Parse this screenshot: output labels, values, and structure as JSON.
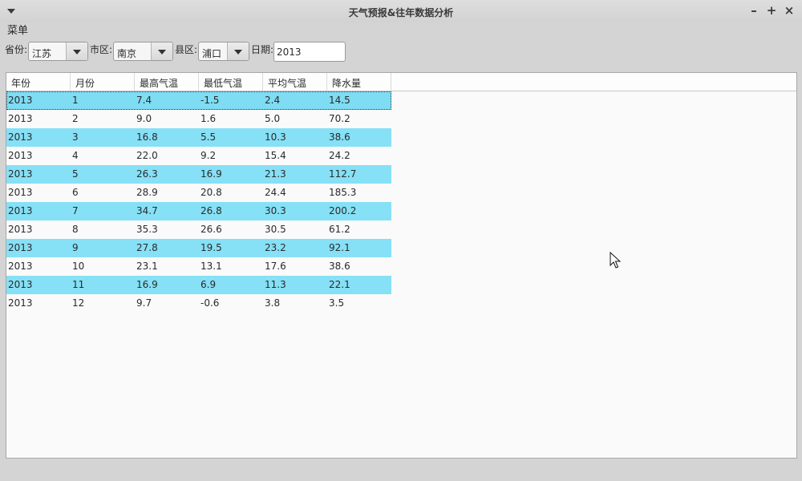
{
  "window": {
    "title": "天气预报&往年数据分析",
    "min_glyph": "–",
    "max_glyph": "+",
    "close_glyph": "×"
  },
  "menubar": {
    "menu_label": "菜单"
  },
  "filters": {
    "province_label": "省份:",
    "province_value": "江苏",
    "city_label": "市区:",
    "city_value": "南京",
    "county_label": "县区:",
    "county_value": "浦口",
    "date_label": "日期:",
    "date_value": "2013"
  },
  "table": {
    "headers": [
      "年份",
      "月份",
      "最高气温",
      "最低气温",
      "平均气温",
      "降水量"
    ],
    "rows": [
      [
        "2013",
        "1",
        "7.4",
        "-1.5",
        "2.4",
        "14.5"
      ],
      [
        "2013",
        "2",
        "9.0",
        "1.6",
        "5.0",
        "70.2"
      ],
      [
        "2013",
        "3",
        "16.8",
        "5.5",
        "10.3",
        "38.6"
      ],
      [
        "2013",
        "4",
        "22.0",
        "9.2",
        "15.4",
        "24.2"
      ],
      [
        "2013",
        "5",
        "26.3",
        "16.9",
        "21.3",
        "112.7"
      ],
      [
        "2013",
        "6",
        "28.9",
        "20.8",
        "24.4",
        "185.3"
      ],
      [
        "2013",
        "7",
        "34.7",
        "26.8",
        "30.3",
        "200.2"
      ],
      [
        "2013",
        "8",
        "35.3",
        "26.6",
        "30.5",
        "61.2"
      ],
      [
        "2013",
        "9",
        "27.8",
        "19.5",
        "23.2",
        "92.1"
      ],
      [
        "2013",
        "10",
        "23.1",
        "13.1",
        "17.6",
        "38.6"
      ],
      [
        "2013",
        "11",
        "16.9",
        "6.9",
        "11.3",
        "22.1"
      ],
      [
        "2013",
        "12",
        "9.7",
        "-0.6",
        "3.8",
        "3.5"
      ]
    ]
  },
  "colors": {
    "alt_row": "#86e0f6"
  }
}
